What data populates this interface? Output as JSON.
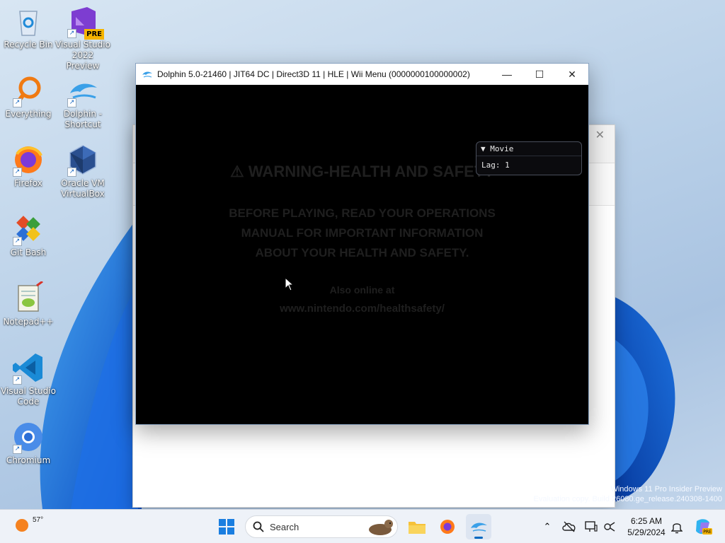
{
  "desktop": {
    "icons": [
      {
        "label": "Recycle Bin",
        "icon": "recycle-bin-icon"
      },
      {
        "label": "Visual Studio 2022 Preview",
        "icon": "visual-studio-icon",
        "badge": "PRE"
      },
      {
        "label": "Everything",
        "icon": "everything-search-icon"
      },
      {
        "label": "Dolphin - Shortcut",
        "icon": "dolphin-icon"
      },
      {
        "label": "Firefox",
        "icon": "firefox-icon"
      },
      {
        "label": "Oracle VM VirtualBox",
        "icon": "virtualbox-icon"
      },
      {
        "label": "Git Bash",
        "icon": "git-bash-icon"
      },
      {
        "label": "Notepad++",
        "icon": "notepad-plus-plus-icon"
      },
      {
        "label": "Visual Studio Code",
        "icon": "vscode-icon"
      },
      {
        "label": "Chromium",
        "icon": "chromium-icon"
      }
    ]
  },
  "dolphin_window": {
    "title": "Dolphin 5.0-21460 | JIT64 DC | Direct3D 11 | HLE | Wii Menu (0000000100000002)",
    "controls": {
      "minimize": "—",
      "maximize": "☐",
      "close": "✕"
    },
    "game_screen": {
      "warning_heading": "WARNING-HEALTH AND SAFETY",
      "warning_lines": [
        "BEFORE PLAYING, READ YOUR OPERATIONS",
        "MANUAL FOR IMPORTANT INFORMATION",
        "ABOUT YOUR HEALTH AND SAFETY."
      ],
      "also_online": "Also online at",
      "url": "www.nintendo.com/healthsafety/"
    },
    "movie_panel": {
      "header": "Movie",
      "lag_label": "Lag:",
      "lag_value": "1"
    }
  },
  "watermark": {
    "line1": "Windows 11 Pro Insider Preview",
    "line2": "Evaluation copy. Build 26080.ge_release.240308-1400"
  },
  "taskbar": {
    "weather_temp": "57°",
    "search_placeholder": "Search",
    "clock_time": "6:25 AM",
    "clock_date": "5/29/2024",
    "pinned": [
      "start-icon",
      "search",
      "file-explorer-icon",
      "firefox-icon",
      "dolphin-icon"
    ],
    "tray": [
      "chevron-up-icon",
      "onedrive-offline-icon",
      "display-icon",
      "network-icon",
      "notification-bell-icon",
      "copilot-icon"
    ]
  }
}
